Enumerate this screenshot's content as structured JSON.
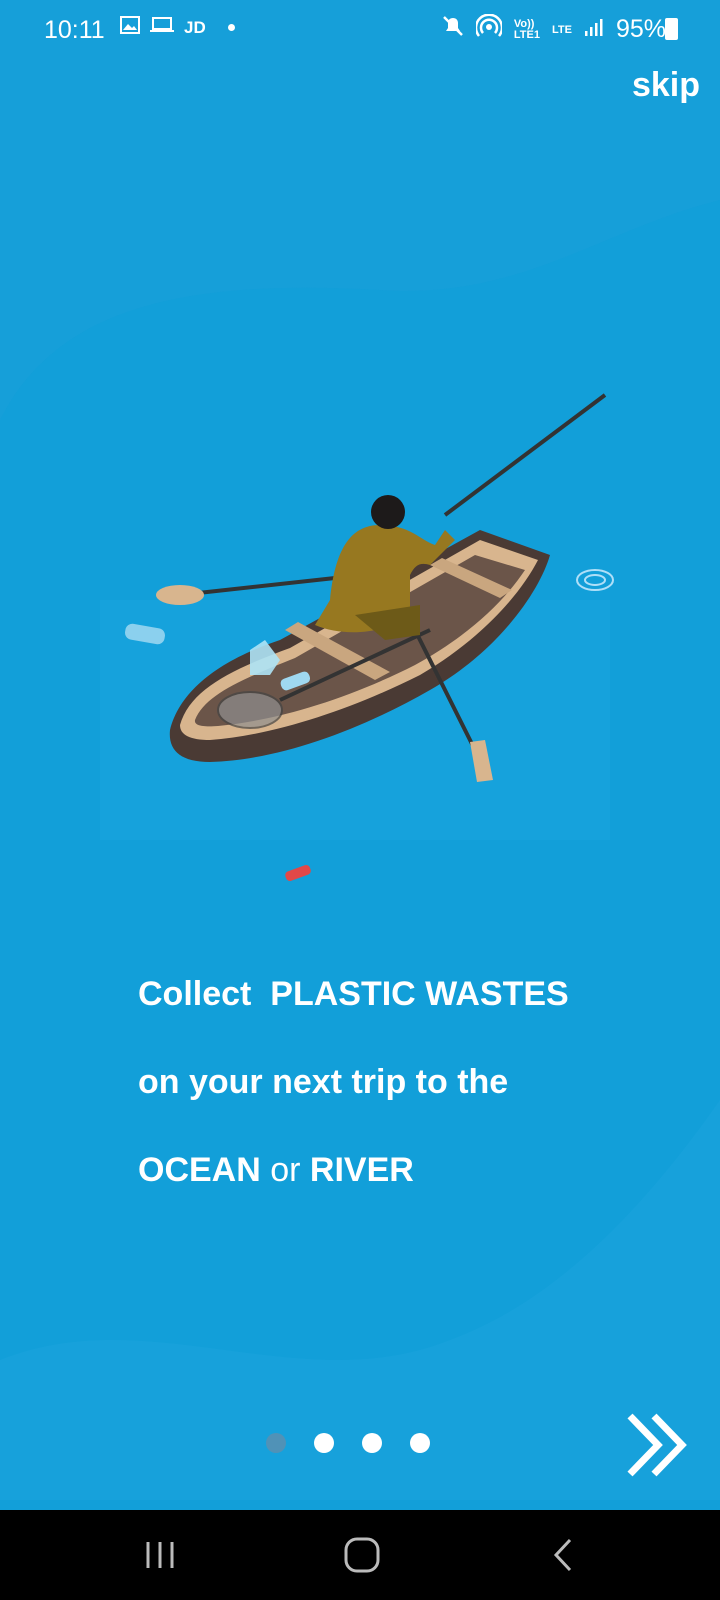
{
  "status_bar": {
    "time": "10:11",
    "left_icons": [
      "image-icon",
      "laptop-icon"
    ],
    "carrier_text": "JD",
    "right_icons": [
      "mute-icon",
      "hotspot-icon",
      "volte-icon",
      "lte-icon",
      "signal-icon"
    ],
    "volte_label": "Vo))\nLTE1",
    "lte_label": "LTE",
    "battery_percent": "95%"
  },
  "onboarding": {
    "skip_label": "skip",
    "line1_prefix": "Collect ",
    "line1_emphasis": "PLASTIC WASTES",
    "line2": "on your next trip to the",
    "line3_a": "OCEAN",
    "line3_mid": " or ",
    "line3_b": "RIVER",
    "page_dots": [
      {
        "active": true
      },
      {
        "active": false
      },
      {
        "active": false
      },
      {
        "active": false
      }
    ],
    "next_icon": "double-chevron-right-icon"
  },
  "nav_bar": {
    "icons": [
      "recent-apps-icon",
      "home-icon",
      "back-icon"
    ]
  },
  "colors": {
    "background": "#169fd9",
    "active_dot": "#5a8fb0",
    "text": "#ffffff"
  }
}
